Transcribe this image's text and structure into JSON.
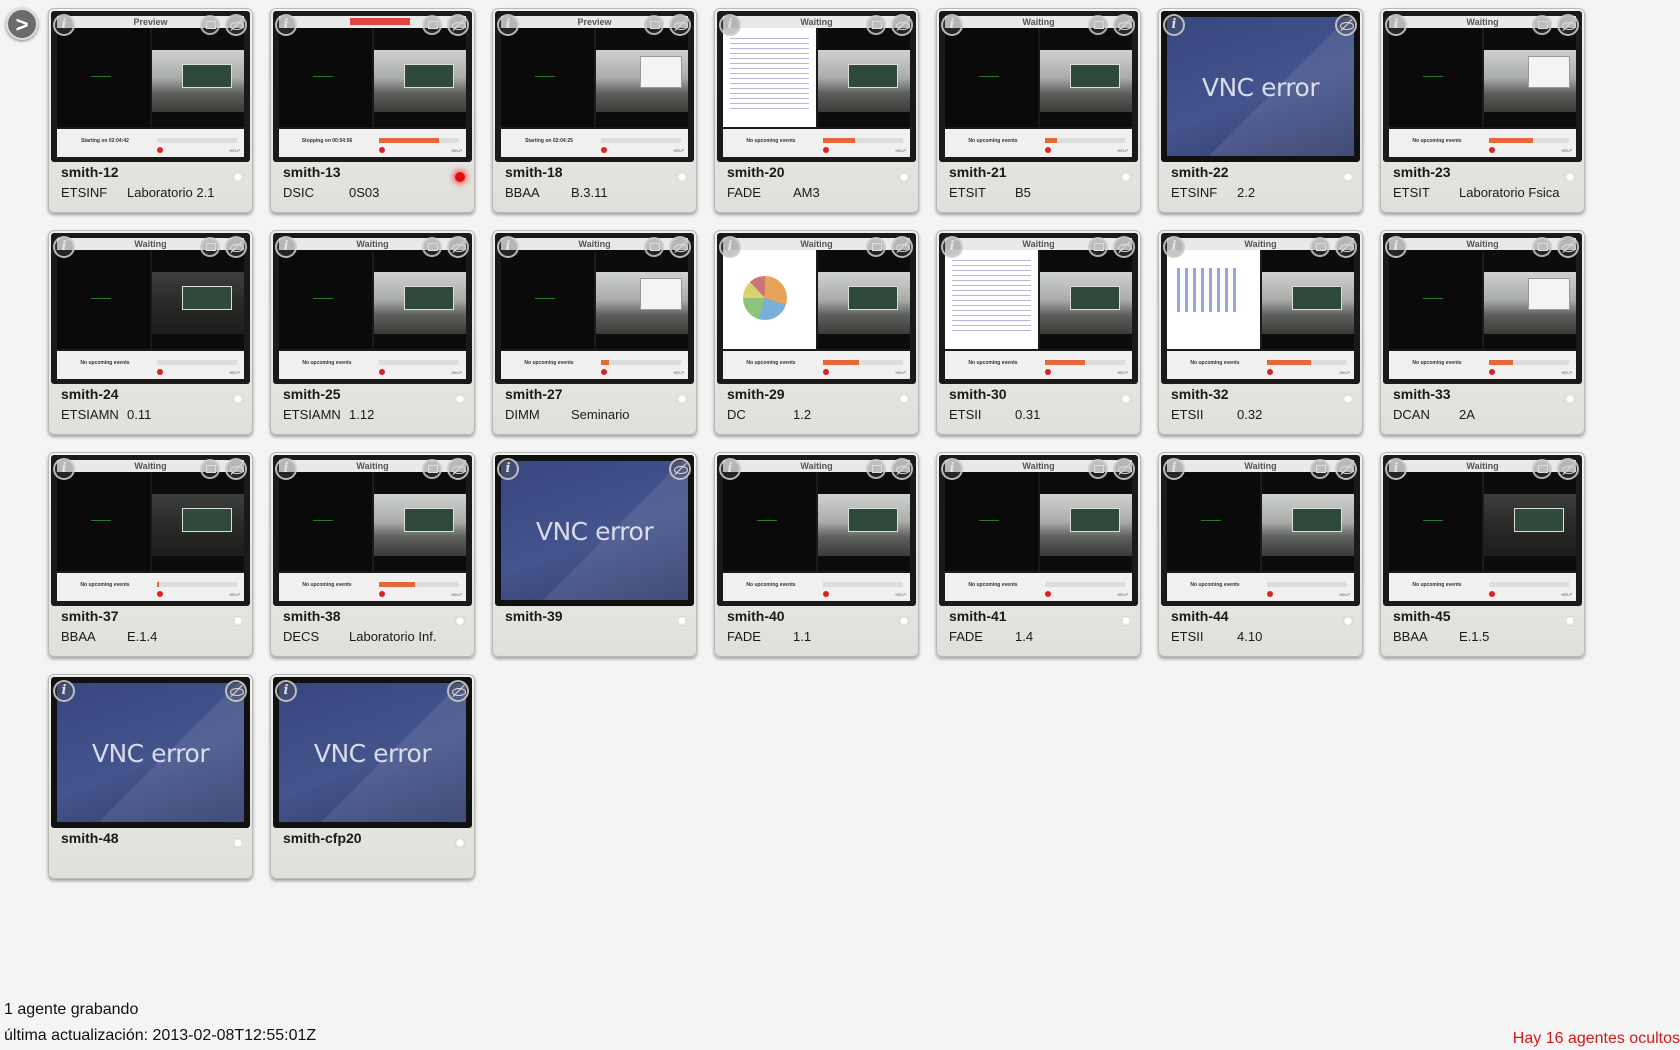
{
  "toggle_label": ">",
  "agents": [
    {
      "name": "smith-12",
      "school": "ETSINF",
      "room": "Laboratorio 2.1",
      "state": "Preview",
      "recording": false,
      "vnc_error": false,
      "right_view": "camera",
      "upcoming": "Starting on 02:04:42",
      "progress": 0
    },
    {
      "name": "smith-13",
      "school": "DSIC",
      "room": "0S03",
      "state": "",
      "recording": true,
      "vnc_error": false,
      "right_view": "camera",
      "upcoming": "Stopping on 00:54:56",
      "progress": 0.75
    },
    {
      "name": "smith-18",
      "school": "BBAA",
      "room": "B.3.11",
      "state": "Preview",
      "recording": false,
      "vnc_error": false,
      "right_view": "projector",
      "upcoming": "Starting on 02:04:25",
      "progress": 0
    },
    {
      "name": "smith-20",
      "school": "FADE",
      "room": "AM3",
      "state": "Waiting",
      "recording": false,
      "vnc_error": false,
      "right_view": "camera",
      "slide": "lines",
      "upcoming": "No upcoming events",
      "progress": 0.4
    },
    {
      "name": "smith-21",
      "school": "ETSIT",
      "room": "B5",
      "state": "Waiting",
      "recording": false,
      "vnc_error": false,
      "right_view": "camera",
      "upcoming": "No upcoming events",
      "progress": 0.15
    },
    {
      "name": "smith-22",
      "school": "ETSINF",
      "room": "2.2",
      "state": "",
      "recording": false,
      "vnc_error": true
    },
    {
      "name": "smith-23",
      "school": "ETSIT",
      "room": "Laboratorio Fsica",
      "state": "Waiting",
      "recording": false,
      "vnc_error": false,
      "right_view": "projector",
      "upcoming": "No upcoming events",
      "progress": 0.55
    },
    {
      "name": "smith-24",
      "school": "ETSIAMN",
      "room": "0.11",
      "state": "Waiting",
      "recording": false,
      "vnc_error": false,
      "right_view": "dark",
      "upcoming": "No upcoming events",
      "progress": 0
    },
    {
      "name": "smith-25",
      "school": "ETSIAMN",
      "room": "1.12",
      "state": "Waiting",
      "recording": false,
      "vnc_error": false,
      "right_view": "camera",
      "upcoming": "No upcoming events",
      "progress": 0
    },
    {
      "name": "smith-27",
      "school": "DIMM",
      "room": "Seminario",
      "state": "Waiting",
      "recording": false,
      "vnc_error": false,
      "right_view": "projector",
      "upcoming": "No upcoming events",
      "progress": 0.1
    },
    {
      "name": "smith-29",
      "school": "DC",
      "room": "1.2",
      "state": "Waiting",
      "recording": false,
      "vnc_error": false,
      "right_view": "camera",
      "slide": "pie",
      "upcoming": "No upcoming events",
      "progress": 0.45
    },
    {
      "name": "smith-30",
      "school": "ETSII",
      "room": "0.31",
      "state": "Waiting",
      "recording": false,
      "vnc_error": false,
      "right_view": "camera",
      "slide": "lines",
      "upcoming": "No upcoming events",
      "progress": 0.5
    },
    {
      "name": "smith-32",
      "school": "ETSII",
      "room": "0.32",
      "state": "Waiting",
      "recording": false,
      "vnc_error": false,
      "right_view": "camera",
      "slide": "chart3d",
      "upcoming": "No upcoming events",
      "progress": 0.55
    },
    {
      "name": "smith-33",
      "school": "DCAN",
      "room": "2A",
      "state": "Waiting",
      "recording": false,
      "vnc_error": false,
      "right_view": "projector",
      "upcoming": "No upcoming events",
      "progress": 0.3
    },
    {
      "name": "smith-37",
      "school": "BBAA",
      "room": "E.1.4",
      "state": "Waiting",
      "recording": false,
      "vnc_error": false,
      "right_view": "dark",
      "upcoming": "No upcoming events",
      "progress": 0.02
    },
    {
      "name": "smith-38",
      "school": "DECS",
      "room": "Laboratorio Inf.",
      "state": "Waiting",
      "recording": false,
      "vnc_error": false,
      "right_view": "camera",
      "upcoming": "No upcoming events",
      "progress": 0.45
    },
    {
      "name": "smith-39",
      "school": "",
      "room": "",
      "state": "",
      "recording": false,
      "vnc_error": true
    },
    {
      "name": "smith-40",
      "school": "FADE",
      "room": "1.1",
      "state": "Waiting",
      "recording": false,
      "vnc_error": false,
      "right_view": "camera",
      "upcoming": "No upcoming events",
      "progress": 0
    },
    {
      "name": "smith-41",
      "school": "FADE",
      "room": "1.4",
      "state": "Waiting",
      "recording": false,
      "vnc_error": false,
      "right_view": "camera",
      "upcoming": "No upcoming events",
      "progress": 0
    },
    {
      "name": "smith-44",
      "school": "ETSII",
      "room": "4.10",
      "state": "Waiting",
      "recording": false,
      "vnc_error": false,
      "right_view": "camera",
      "upcoming": "No upcoming events",
      "progress": 0
    },
    {
      "name": "smith-45",
      "school": "BBAA",
      "room": "E.1.5",
      "state": "Waiting",
      "recording": false,
      "vnc_error": false,
      "right_view": "dark",
      "upcoming": "No upcoming events",
      "progress": 0
    },
    {
      "name": "smith-48",
      "school": "",
      "room": "",
      "state": "",
      "recording": false,
      "vnc_error": true
    },
    {
      "name": "smith-cfp20",
      "school": "",
      "room": "",
      "state": "",
      "recording": false,
      "vnc_error": true
    }
  ],
  "vnc_error_text": "VNC error",
  "info_glyph": "i",
  "footer": {
    "recording_count": "1 agente grabando",
    "last_update": "última actualización: 2013-02-08T12:55:01Z",
    "hidden_agents": "Hay 16 agentes ocultos"
  },
  "colors": {
    "recording_led": "#e01010",
    "hidden_agents_text": "#d01a1a",
    "vnc_error_bg": "#3f4f86"
  }
}
